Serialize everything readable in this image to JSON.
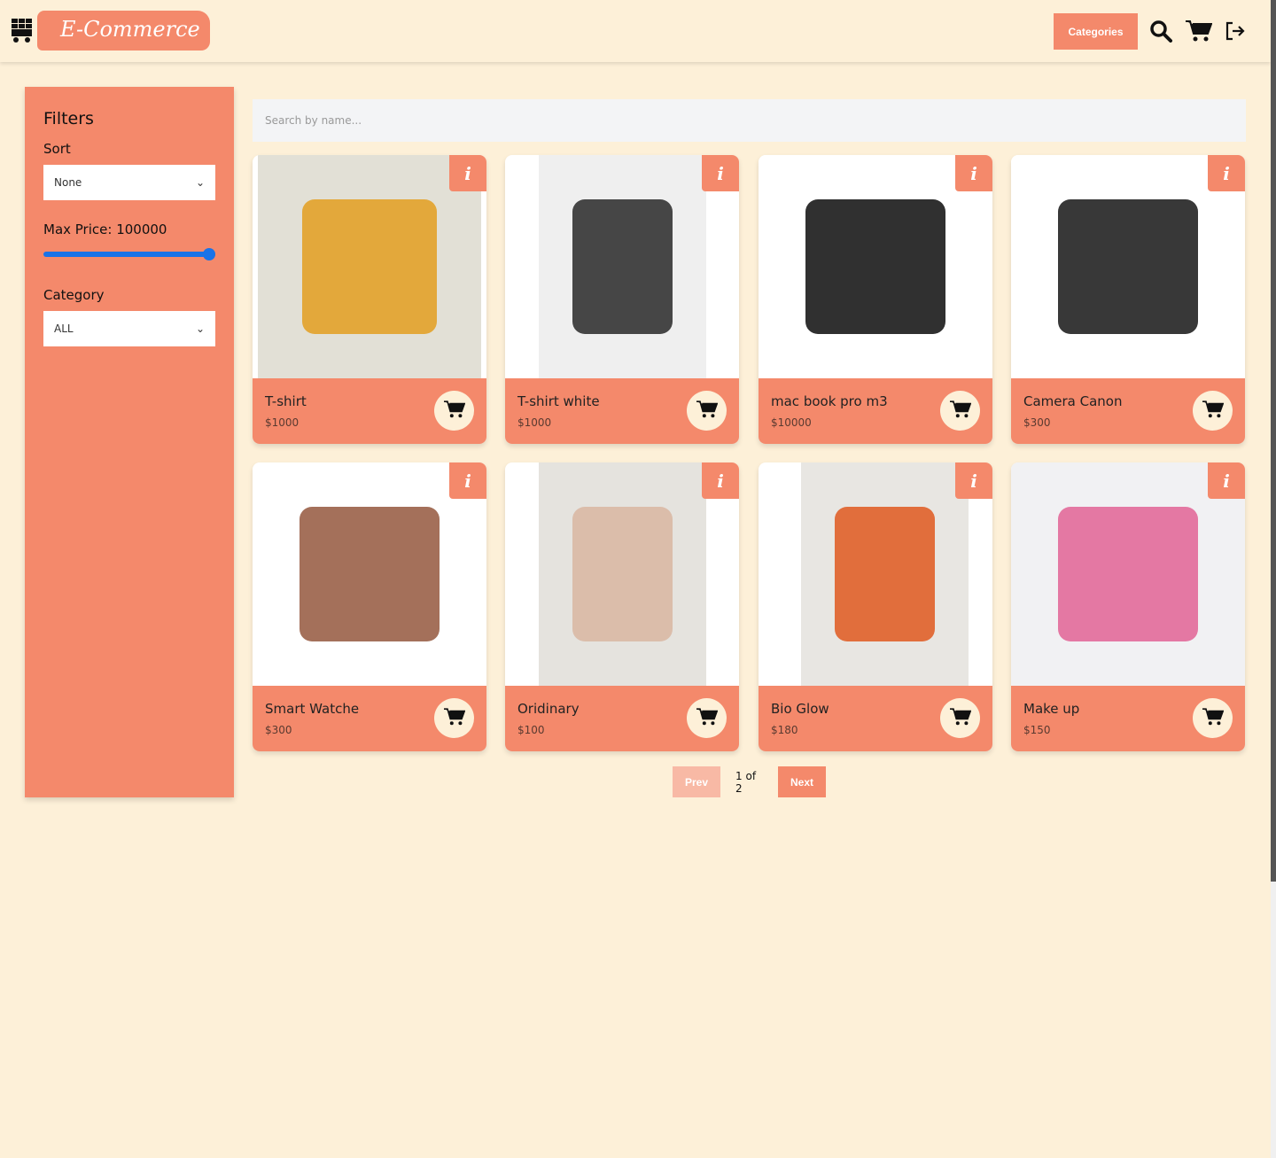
{
  "header": {
    "logo_text": "E-Commerce",
    "categories_label": "Categories"
  },
  "filters": {
    "title": "Filters",
    "sort_label": "Sort",
    "sort_value": "None",
    "max_price_label": "Max Price: 100000",
    "max_price_value": 100000,
    "category_label": "Category",
    "category_value": "ALL"
  },
  "search": {
    "placeholder": "Search by name..."
  },
  "products": [
    {
      "name": "T-shirt",
      "price": "$1000",
      "img": "#e2e0d6",
      "obj": "#e3a22a"
    },
    {
      "name": "T-shirt white",
      "price": "$1000",
      "img": "#efefef",
      "obj": "#333333"
    },
    {
      "name": "mac book pro m3",
      "price": "$10000",
      "img": "#ffffff",
      "obj": "#1a1a1a"
    },
    {
      "name": "Camera Canon",
      "price": "$300",
      "img": "#ffffff",
      "obj": "#222222"
    },
    {
      "name": "Smart Watche",
      "price": "$300",
      "img": "#ffffff",
      "obj": "#9a6048"
    },
    {
      "name": "Oridinary",
      "price": "$100",
      "img": "#e5e3de",
      "obj": "#d9b8a4"
    },
    {
      "name": "Bio Glow",
      "price": "$180",
      "img": "#e8e6e2",
      "obj": "#e0602a"
    },
    {
      "name": "Make up",
      "price": "$150",
      "img": "#f1f1f3",
      "obj": "#e26a9a"
    }
  ],
  "pagination": {
    "prev": "Prev",
    "status": "1 of 2",
    "next": "Next"
  },
  "colors": {
    "accent": "#f4896b",
    "background": "#fdf0d8",
    "slider": "#1a73e8"
  }
}
